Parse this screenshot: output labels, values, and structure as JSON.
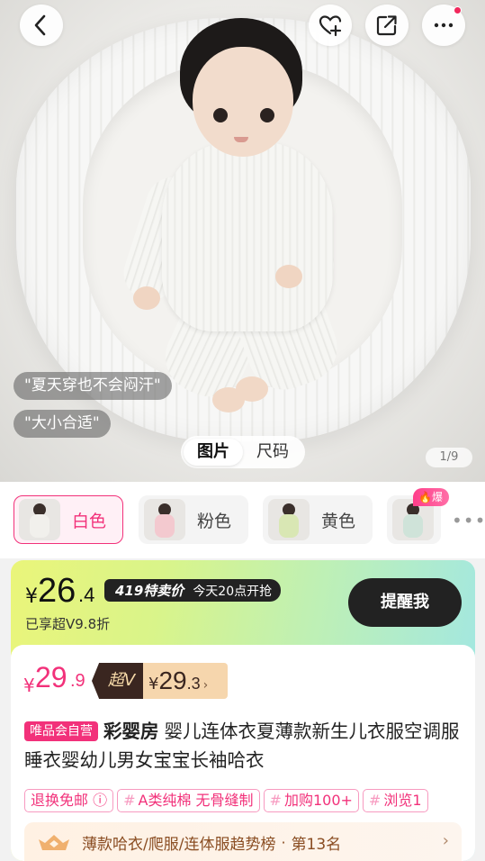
{
  "hero": {
    "review_tags": [
      "\"夏天穿也不会闷汗\"",
      "\"大小合适\""
    ],
    "segment_tabs": [
      {
        "label": "图片",
        "active": true
      },
      {
        "label": "尺码",
        "active": false
      }
    ],
    "page_indicator": "1/9"
  },
  "nav": {
    "icons": [
      "back-icon",
      "favorite-add-icon",
      "share-icon",
      "more-icon"
    ]
  },
  "colors": {
    "options": [
      {
        "label": "白色",
        "selected": true,
        "swatch": "#f1f0ec"
      },
      {
        "label": "粉色",
        "selected": false,
        "swatch": "#f3c9cf"
      },
      {
        "label": "黄色",
        "selected": false,
        "swatch": "#d9e7b4"
      },
      {
        "label": "",
        "selected": false,
        "swatch": "#cfe3d9"
      }
    ],
    "hot_badge": "爆"
  },
  "promo": {
    "sale_currency": "¥",
    "sale_int": "26",
    "sale_dec": ".4",
    "sale_tag_a": "419特卖价",
    "sale_tag_b": "今天20点开抢",
    "vip_note": "已享超V9.8折",
    "remind_label": "提醒我"
  },
  "price": {
    "currency": "¥",
    "int": "29",
    "dec": ".9",
    "super_v_label": "超V",
    "super_v_currency": "¥",
    "super_v_int": "29",
    "super_v_dec": ".3",
    "super_v_chevron": "›"
  },
  "product": {
    "badge": "唯品会自营",
    "brand": "彩婴房",
    "title": "婴儿连体衣夏薄款新生儿衣服空调服睡衣婴幼儿男女宝宝长袖哈衣"
  },
  "tags": [
    {
      "text": "退换免邮 ⓘ",
      "hash": false
    },
    {
      "text": "A类纯棉 无骨缝制",
      "hash": true
    },
    {
      "text": "加购100+",
      "hash": true
    },
    {
      "text": "浏览1",
      "hash": true
    }
  ],
  "ranking": {
    "category": "薄款哈衣/爬服/连体服趋势榜",
    "separator": "·",
    "position": "第13名",
    "chevron": "›"
  },
  "theme": {
    "accent": "#f2317a",
    "dark": "#222222",
    "gold": "#f6d6ad"
  }
}
